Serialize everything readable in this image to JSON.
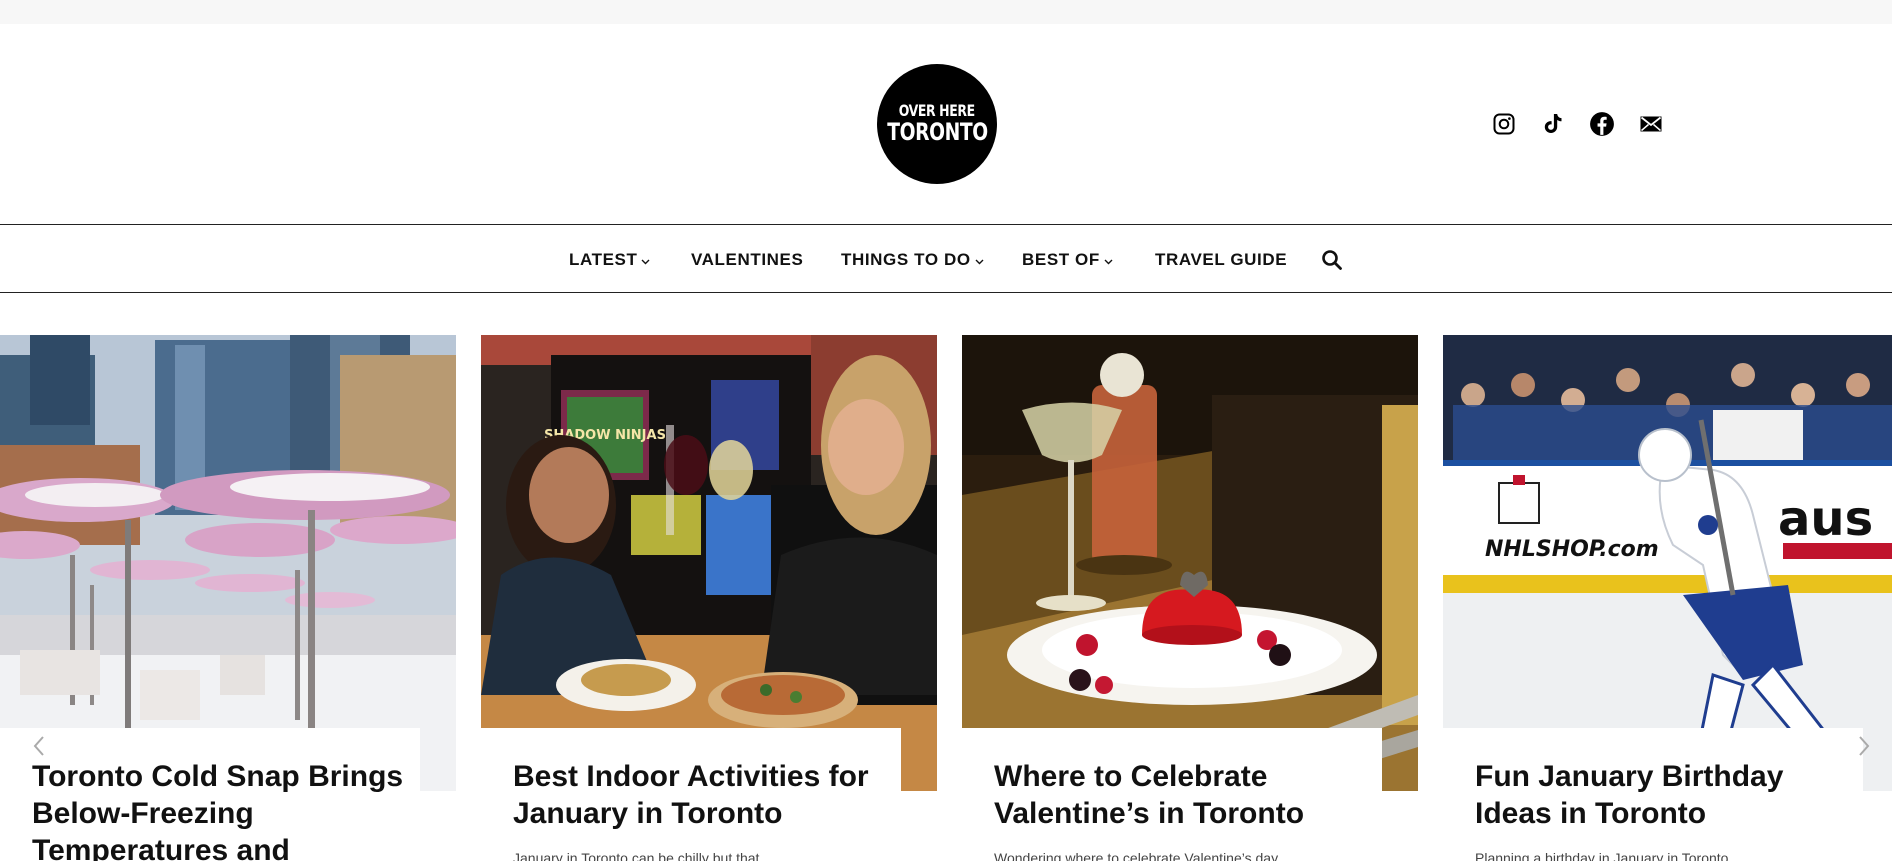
{
  "site": {
    "logo_line1": "OVER HERE",
    "logo_line2": "TORONTO"
  },
  "socials": [
    {
      "name": "instagram-icon"
    },
    {
      "name": "tiktok-icon"
    },
    {
      "name": "facebook-icon"
    },
    {
      "name": "email-icon"
    }
  ],
  "nav": {
    "items": [
      {
        "label": "LATEST",
        "dropdown": true
      },
      {
        "label": "VALENTINES",
        "dropdown": false
      },
      {
        "label": "THINGS TO DO",
        "dropdown": true
      },
      {
        "label": "BEST OF",
        "dropdown": true
      },
      {
        "label": "TRAVEL GUIDE",
        "dropdown": false
      }
    ],
    "search_icon": "search-icon"
  },
  "slides": [
    {
      "title": "Toronto Cold Snap Brings Below-Freezing Temperatures and",
      "excerpt": ""
    },
    {
      "title": "Best Indoor Activities for January in Toronto",
      "excerpt": "January in Toronto can be chilly but that"
    },
    {
      "title": "Where to Celebrate Valentine’s in Toronto",
      "excerpt": "Wondering where to celebrate Valentine’s day"
    },
    {
      "title": "Fun January Birthday Ideas in Toronto",
      "excerpt": "Planning a birthday in January in Toronto"
    }
  ],
  "photo_text": {
    "board_game": "SHADOW NINJAS",
    "rink_ad": "NHLSHOP.com",
    "rink_ad2": "aus"
  },
  "colors": {
    "accent": "#000000",
    "text": "#111111",
    "nav_border": "#222222"
  }
}
